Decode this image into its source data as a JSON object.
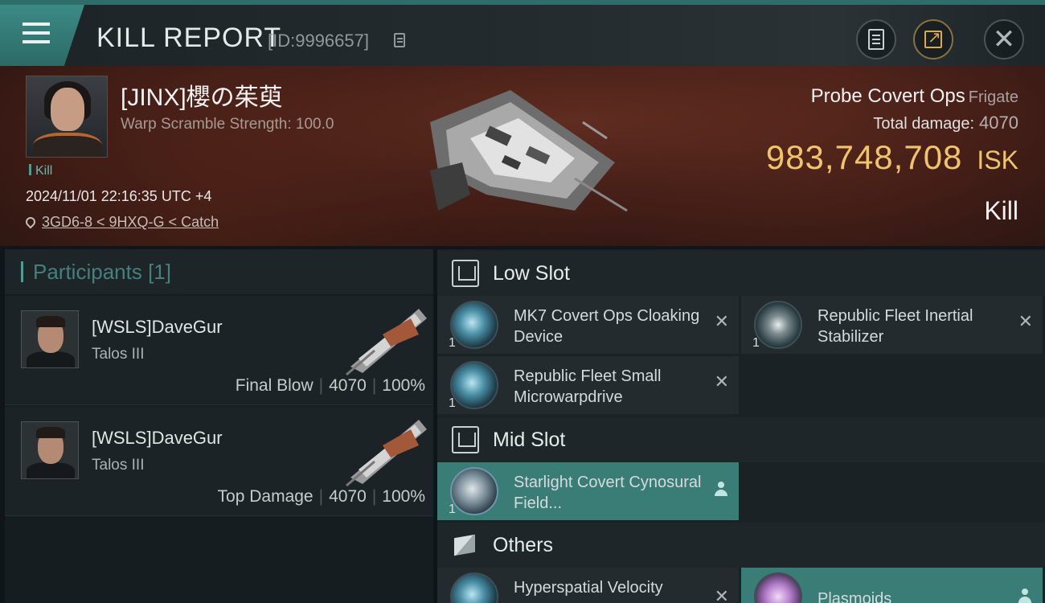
{
  "header": {
    "title": "KILL REPORT",
    "report_id": "[ID:9996657]"
  },
  "victim": {
    "name": "[JINX]櫻の茱萸",
    "subtitle": "Warp Scramble Strength: 100.0",
    "tag": "Kill",
    "datetime": "2024/11/01 22:16:35 UTC +4",
    "location": "3GD6-8 < 9HXQ-G < Catch",
    "ship_name": "Probe Covert Ops",
    "ship_class": "Frigate",
    "total_damage_label": "Total damage:",
    "total_damage": "4070",
    "isk_value": "983,748,708",
    "isk_unit": "ISK",
    "result": "Kill"
  },
  "participants": {
    "title": "Participants",
    "count": "[1]",
    "rows": [
      {
        "name": "[WSLS]DaveGur",
        "ship": "Talos III",
        "role": "Final Blow",
        "damage": "4070",
        "percent": "100%"
      },
      {
        "name": "[WSLS]DaveGur",
        "ship": "Talos III",
        "role": "Top Damage",
        "damage": "4070",
        "percent": "100%"
      }
    ]
  },
  "fitting": {
    "low_slot": {
      "title": "Low Slot",
      "modules": [
        {
          "name": "MK7 Covert Ops Cloaking Device",
          "qty": "1",
          "status": "destroyed"
        },
        {
          "name": "Republic Fleet Inertial Stabilizer",
          "qty": "1",
          "status": "destroyed"
        },
        {
          "name": "Republic Fleet Small Microwarpdrive",
          "qty": "1",
          "status": "destroyed"
        }
      ]
    },
    "mid_slot": {
      "title": "Mid Slot",
      "modules": [
        {
          "name": "Starlight Covert Cynosural Field...",
          "qty": "1",
          "status": "dropped"
        }
      ]
    },
    "others": {
      "title": "Others",
      "modules": [
        {
          "name": "Hyperspatial Velocity",
          "status": "destroyed"
        },
        {
          "name": "Plasmoids",
          "status": "dropped"
        }
      ]
    }
  },
  "colors": {
    "accent": "#3a7d77",
    "isk": "#f0c46a",
    "banner": "#3d1c16"
  }
}
